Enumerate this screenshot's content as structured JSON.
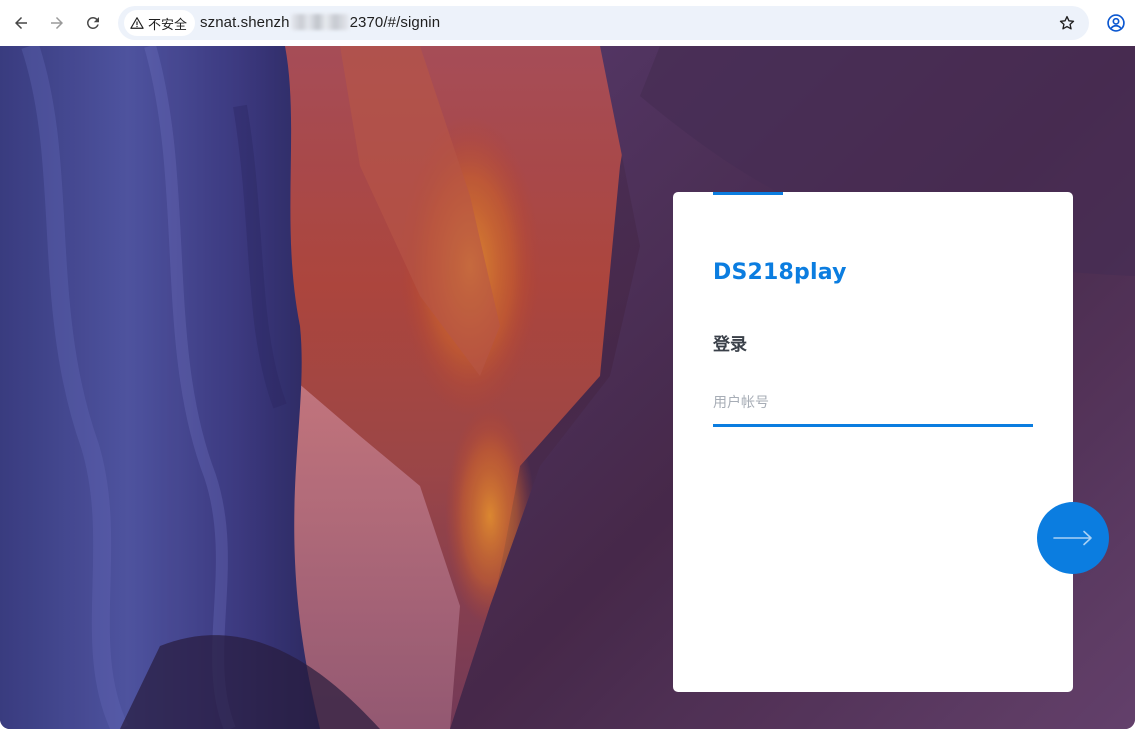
{
  "browser": {
    "security_label": "不安全",
    "url_prefix": "sznat.shenzh",
    "url_suffix": "2370/#/signin",
    "icons": {
      "back": "back-arrow-icon",
      "forward": "forward-arrow-icon",
      "reload": "reload-icon",
      "warning": "warning-triangle-icon",
      "bookmark": "star-icon",
      "profile": "account-circle-icon"
    }
  },
  "login": {
    "device_name": "DS218play",
    "heading": "登录",
    "username_placeholder": "用户帐号",
    "next_icon": "arrow-right-icon"
  },
  "colors": {
    "accent": "#0b7de0",
    "heading": "#3a4049",
    "placeholder": "#a7adb6"
  }
}
